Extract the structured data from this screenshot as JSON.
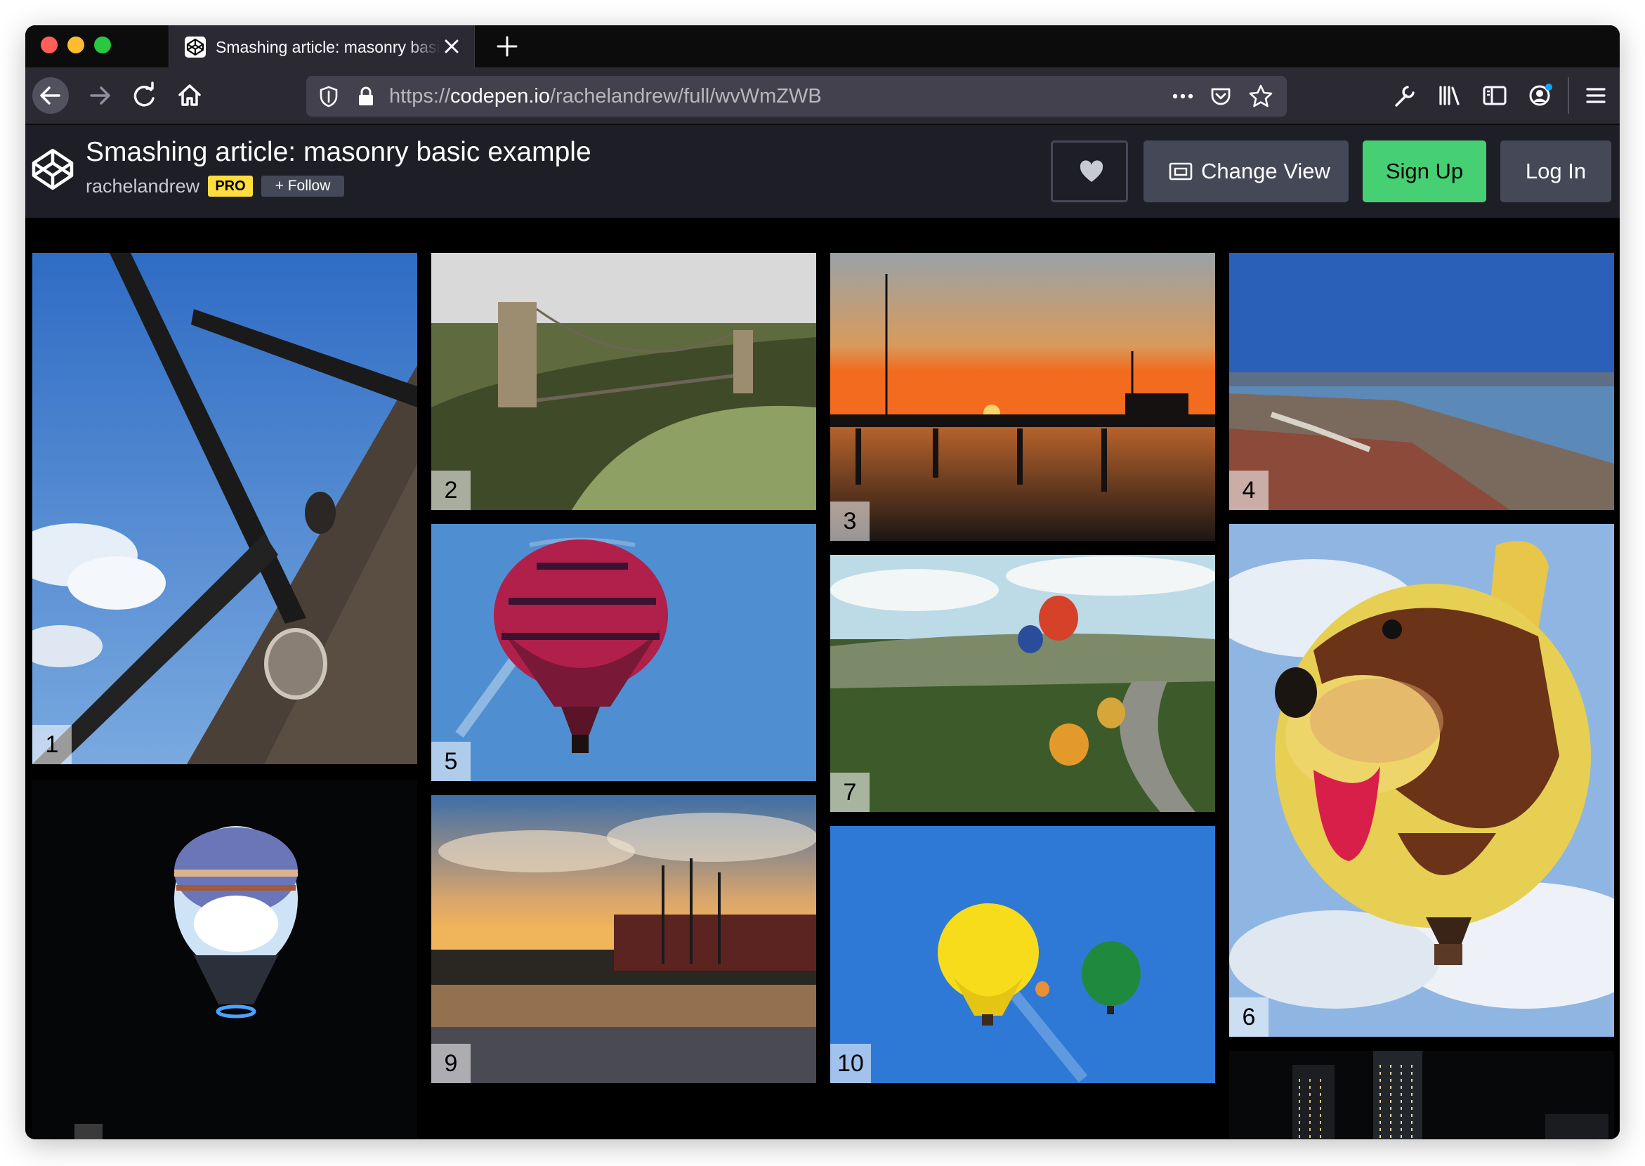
{
  "browser": {
    "tab_title": "Smashing article: masonry basic example",
    "url_scheme": "https://",
    "url_host": "codepen.io",
    "url_path": "/rachelandrew/full/wvWmZWB"
  },
  "pen": {
    "title": "Smashing article: masonry basic example",
    "author": "rachelandrew",
    "pro_badge": "PRO",
    "follow_label": "+ Follow",
    "change_view_label": "Change View",
    "signup_label": "Sign Up",
    "login_label": "Log In"
  },
  "colors": {
    "signup_green": "#47cf73",
    "pro_yellow": "#ffdd40",
    "header_bg": "#1e1f26",
    "button_gray": "#444857"
  },
  "gallery": {
    "items": [
      {
        "label": "1",
        "subject": "windmill against blue sky"
      },
      {
        "label": "2",
        "subject": "suspension bridge over gorge"
      },
      {
        "label": "3",
        "subject": "marina at sunset"
      },
      {
        "label": "4",
        "subject": "city and river view"
      },
      {
        "label": "5",
        "subject": "red hot air balloon"
      },
      {
        "label": "6",
        "subject": "dog-shaped hot air balloon"
      },
      {
        "label": "7",
        "subject": "many balloons over river valley"
      },
      {
        "label": "",
        "subject": "balloon at night"
      },
      {
        "label": "9",
        "subject": "tall ship in harbour at sunset"
      },
      {
        "label": "10",
        "subject": "yellow and green balloons"
      },
      {
        "label": "",
        "subject": "city skyline at night"
      }
    ]
  }
}
